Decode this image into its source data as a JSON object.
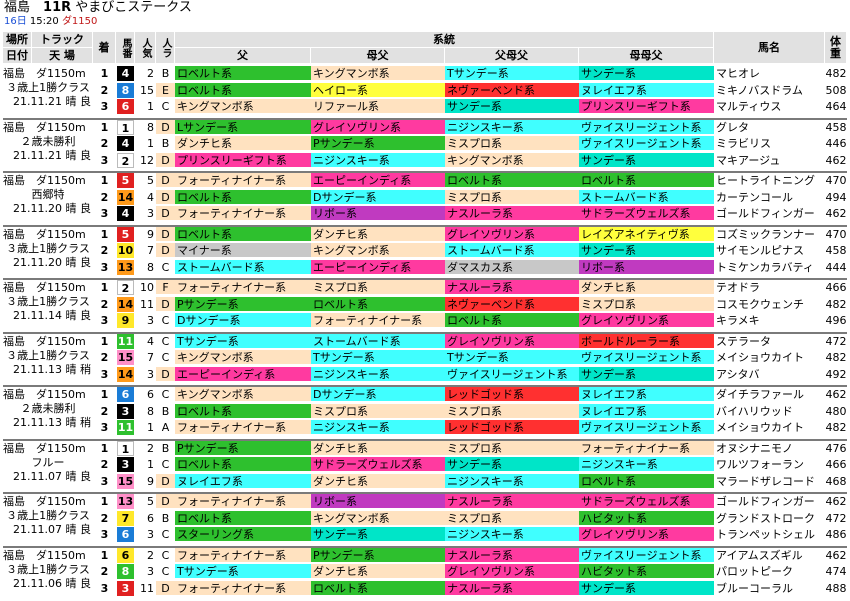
{
  "header": {
    "venue": "福島",
    "race_no": "11R",
    "race_name": "やまびこステークス",
    "day": "16日",
    "time": "15:20",
    "dist": "ダ1150"
  },
  "columns": {
    "venue_track": "場所",
    "track": "トラック",
    "date": "日付",
    "weather": "天 場",
    "chaku": "着",
    "umaban": "馬番",
    "ninki": "人気",
    "race_class": "人ラ",
    "lineage": "系統",
    "father": "父",
    "mother_side": "母父",
    "father_mother": "父母父",
    "mother_mother": "母母父",
    "horse_name": "馬名",
    "weight": "体重"
  },
  "colors": {
    "ロベルト系": "#2ec02e",
    "キングマンボ系": "#ffe2c0",
    "Tサンデー系": "#40ffff",
    "サンデー系": "#00e5c8",
    "ヘイロー系": "#ffff3d",
    "ネヴァーベンド系": "#ff3030",
    "ヌレイエフ系": "#40ffff",
    "リファール系": "#ffe2c0",
    "プリンスリーギフト系": "#ff3aa0",
    "Lサンデー系": "#40ffff",
    "グレイソヴリン系": "#ff3aa0",
    "ニジンスキー系": "#40ffff",
    "ヴァイスリージェント系": "#40ffff",
    "ダンチヒ系": "#ffe2c0",
    "Pサンデー系": "#2ec02e",
    "ミスプロ系": "#ffe2c0",
    "フォーティナイナー系": "#ffe2c0",
    "エーピーインディ系": "#ff3aa0",
    "ロベルト系2": "#2ec02e",
    "Dサンデー系": "#40ffff",
    "ストームバード系": "#40ffff",
    "リボー系": "#c03ac0",
    "ナスルーラ系": "#ff3aa0",
    "サドラーズウェルズ系": "#ff3aa0",
    "レイズアネイティヴ系": "#ffff3d",
    "マイナー系": "#c8c8c8",
    "ダマスカス系": "#c8c8c8",
    "ハビタット系": "#2ec02e",
    "ボールドルーラー系": "#ff3030",
    "レッドゴッド系": "#ff3030",
    "スターリング系": "#2ec02e"
  },
  "races": [
    {
      "venue_dist": "福島　ダ1150m",
      "cls": "３歳上1勝クラス",
      "date_w": "21.11.21 晴 良",
      "rows": [
        {
          "chaku": "1",
          "ban": "4",
          "waku": "#000000",
          "wakuText": "#ffffff",
          "ninki": "2",
          "rl": "B",
          "rlc": "#ffffff",
          "f": "ロベルト系",
          "fc": "#2ec02e",
          "mf": "キングマンボ系",
          "mfc": "#ffe2c0",
          "fmf": "Tサンデー系",
          "fmfc": "#40ffff",
          "mmf": "サンデー系",
          "mmfc": "#00e5c8",
          "name": "マヒオレ",
          "w": "482"
        },
        {
          "chaku": "2",
          "ban": "8",
          "waku": "#1a7cd6",
          "wakuText": "#ffffff",
          "ninki": "15",
          "rl": "E",
          "rlc": "#ffe2c0",
          "f": "ロベルト系",
          "fc": "#2ec02e",
          "mf": "ヘイロー系",
          "mfc": "#ffff3d",
          "fmf": "ネヴァーベンド系",
          "fmfc": "#ff3030",
          "mmf": "ヌレイエフ系",
          "mmfc": "#40ffff",
          "name": "ミキノバスドラム",
          "w": "508"
        },
        {
          "chaku": "3",
          "ban": "6",
          "waku": "#e02020",
          "wakuText": "#ffffff",
          "ninki": "1",
          "rl": "C",
          "rlc": "#ffffff",
          "f": "キングマンボ系",
          "fc": "#ffe2c0",
          "mf": "リファール系",
          "mfc": "#ffe2c0",
          "fmf": "サンデー系",
          "fmfc": "#00e5c8",
          "mmf": "プリンスリーギフト系",
          "mmfc": "#ff3aa0",
          "name": "マルティウス",
          "w": "464"
        }
      ]
    },
    {
      "venue_dist": "福島　ダ1150m",
      "cls": "２歳未勝利",
      "date_w": "21.11.21 晴 良",
      "rows": [
        {
          "chaku": "1",
          "ban": "1",
          "waku": "#ffffff",
          "wakuText": "#000000",
          "ninki": "8",
          "rl": "D",
          "rlc": "#ffe2c0",
          "f": "Lサンデー系",
          "fc": "#2ec02e",
          "mf": "グレイソヴリン系",
          "mfc": "#ff3aa0",
          "fmf": "ニジンスキー系",
          "fmfc": "#40ffff",
          "mmf": "ヴァイスリージェント系",
          "mmfc": "#40ffff",
          "name": "グレタ",
          "w": "458"
        },
        {
          "chaku": "2",
          "ban": "4",
          "waku": "#000000",
          "wakuText": "#ffffff",
          "ninki": "1",
          "rl": "B",
          "rlc": "#ffffff",
          "f": "ダンチヒ系",
          "fc": "#ffe2c0",
          "mf": "Pサンデー系",
          "mfc": "#2ec02e",
          "fmf": "ミスプロ系",
          "fmfc": "#ffe2c0",
          "mmf": "ヴァイスリージェント系",
          "mmfc": "#40ffff",
          "name": "ミラビリス",
          "w": "446"
        },
        {
          "chaku": "3",
          "ban": "2",
          "waku": "#ffffff",
          "wakuText": "#000000",
          "ninki": "12",
          "rl": "D",
          "rlc": "#ffe2c0",
          "f": "プリンスリーギフト系",
          "fc": "#ff3aa0",
          "mf": "ニジンスキー系",
          "mfc": "#40ffff",
          "fmf": "キングマンボ系",
          "fmfc": "#ffe2c0",
          "mmf": "サンデー系",
          "mmfc": "#00e5c8",
          "name": "マキアージュ",
          "w": "462"
        }
      ]
    },
    {
      "venue_dist": "福島　ダ1150m",
      "cls": "西郷特",
      "date_w": "21.11.20 晴 良",
      "rows": [
        {
          "chaku": "1",
          "ban": "5",
          "waku": "#e02020",
          "wakuText": "#ffffff",
          "ninki": "5",
          "rl": "D",
          "rlc": "#ffe2c0",
          "f": "フォーティナイナー系",
          "fc": "#ffe2c0",
          "mf": "エーピーインディ系",
          "mfc": "#ff3aa0",
          "fmf": "ロベルト系",
          "fmfc": "#2ec02e",
          "mmf": "ロベルト系",
          "mmfc": "#2ec02e",
          "name": "ヒートライトニング",
          "w": "470"
        },
        {
          "chaku": "2",
          "ban": "14",
          "waku": "#ff9a1a",
          "wakuText": "#000000",
          "ninki": "4",
          "rl": "D",
          "rlc": "#ffe2c0",
          "f": "ロベルト系",
          "fc": "#2ec02e",
          "mf": "Dサンデー系",
          "mfc": "#40ffff",
          "fmf": "ミスプロ系",
          "fmfc": "#ffe2c0",
          "mmf": "ストームバード系",
          "mmfc": "#40ffff",
          "name": "カーテンコール",
          "w": "494"
        },
        {
          "chaku": "3",
          "ban": "4",
          "waku": "#000000",
          "wakuText": "#ffffff",
          "ninki": "3",
          "rl": "D",
          "rlc": "#ffe2c0",
          "f": "フォーティナイナー系",
          "fc": "#ffe2c0",
          "mf": "リボー系",
          "mfc": "#c03ac0",
          "fmf": "ナスルーラ系",
          "fmfc": "#ff3aa0",
          "mmf": "サドラーズウェルズ系",
          "mmfc": "#ff3aa0",
          "name": "ゴールドフィンガー",
          "w": "462"
        }
      ]
    },
    {
      "venue_dist": "福島　ダ1150m",
      "cls": "３歳上1勝クラス",
      "date_w": "21.11.20 晴 良",
      "rows": [
        {
          "chaku": "1",
          "ban": "5",
          "waku": "#e02020",
          "wakuText": "#ffffff",
          "ninki": "9",
          "rl": "D",
          "rlc": "#ffe2c0",
          "f": "ロベルト系",
          "fc": "#2ec02e",
          "mf": "ダンチヒ系",
          "mfc": "#ffe2c0",
          "fmf": "グレイソヴリン系",
          "fmfc": "#ff3aa0",
          "mmf": "レイズアネイティヴ系",
          "mmfc": "#ffff3d",
          "name": "コズミックランナー",
          "w": "470"
        },
        {
          "chaku": "2",
          "ban": "10",
          "waku": "#ffe82a",
          "wakuText": "#000000",
          "ninki": "7",
          "rl": "D",
          "rlc": "#ffe2c0",
          "f": "マイナー系",
          "fc": "#c8c8c8",
          "mf": "キングマンボ系",
          "mfc": "#ffe2c0",
          "fmf": "ストームバード系",
          "fmfc": "#40ffff",
          "mmf": "サンデー系",
          "mmfc": "#00e5c8",
          "name": "サイモンルピナス",
          "w": "458"
        },
        {
          "chaku": "3",
          "ban": "13",
          "waku": "#ff9a1a",
          "wakuText": "#000000",
          "ninki": "8",
          "rl": "C",
          "rlc": "#ffffff",
          "f": "ストームバード系",
          "fc": "#40ffff",
          "mf": "エーピーインディ系",
          "mfc": "#ff3aa0",
          "fmf": "ダマスカス系",
          "fmfc": "#c8c8c8",
          "mmf": "リボー系",
          "mmfc": "#c03ac0",
          "name": "トミケンカラバティ",
          "w": "444"
        }
      ]
    },
    {
      "venue_dist": "福島　ダ1150m",
      "cls": "３歳上1勝クラス",
      "date_w": "21.11.14 晴 良",
      "rows": [
        {
          "chaku": "1",
          "ban": "2",
          "waku": "#ffffff",
          "wakuText": "#000000",
          "ninki": "10",
          "rl": "F",
          "rlc": "#ffe2c0",
          "f": "フォーティナイナー系",
          "fc": "#ffe2c0",
          "mf": "ミスプロ系",
          "mfc": "#ffe2c0",
          "fmf": "ナスルーラ系",
          "fmfc": "#ff3aa0",
          "mmf": "ダンチヒ系",
          "mmfc": "#ffe2c0",
          "name": "テオドラ",
          "w": "466"
        },
        {
          "chaku": "2",
          "ban": "14",
          "waku": "#ff9a1a",
          "wakuText": "#000000",
          "ninki": "11",
          "rl": "D",
          "rlc": "#ffe2c0",
          "f": "Pサンデー系",
          "fc": "#2ec02e",
          "mf": "ロベルト系",
          "mfc": "#2ec02e",
          "fmf": "ネヴァーベンド系",
          "fmfc": "#ff3030",
          "mmf": "ミスプロ系",
          "mmfc": "#ffe2c0",
          "name": "コスモクウェンチ",
          "w": "482"
        },
        {
          "chaku": "3",
          "ban": "9",
          "waku": "#ffe82a",
          "wakuText": "#000000",
          "ninki": "3",
          "rl": "C",
          "rlc": "#ffffff",
          "f": "Dサンデー系",
          "fc": "#40ffff",
          "mf": "フォーティナイナー系",
          "mfc": "#ffe2c0",
          "fmf": "ロベルト系",
          "fmfc": "#2ec02e",
          "mmf": "グレイソヴリン系",
          "mmfc": "#ff3aa0",
          "name": "キラメキ",
          "w": "496"
        }
      ]
    },
    {
      "venue_dist": "福島　ダ1150m",
      "cls": "３歳上1勝クラス",
      "date_w": "21.11.13 晴 稍",
      "rows": [
        {
          "chaku": "1",
          "ban": "11",
          "waku": "#2ec02e",
          "wakuText": "#ffffff",
          "ninki": "4",
          "rl": "C",
          "rlc": "#ffffff",
          "f": "Tサンデー系",
          "fc": "#40ffff",
          "mf": "ストームバード系",
          "mfc": "#40ffff",
          "fmf": "グレイソヴリン系",
          "fmfc": "#ff3aa0",
          "mmf": "ボールドルーラー系",
          "mmfc": "#ff3030",
          "name": "ステラータ",
          "w": "472"
        },
        {
          "chaku": "2",
          "ban": "15",
          "waku": "#ff8fc8",
          "wakuText": "#000000",
          "ninki": "7",
          "rl": "C",
          "rlc": "#ffffff",
          "f": "キングマンボ系",
          "fc": "#ffe2c0",
          "mf": "Tサンデー系",
          "mfc": "#40ffff",
          "fmf": "Tサンデー系",
          "fmfc": "#40ffff",
          "mmf": "ヴァイスリージェント系",
          "mmfc": "#40ffff",
          "name": "メイショウカイト",
          "w": "482"
        },
        {
          "chaku": "3",
          "ban": "14",
          "waku": "#ff9a1a",
          "wakuText": "#000000",
          "ninki": "3",
          "rl": "D",
          "rlc": "#ffe2c0",
          "f": "エーピーインディ系",
          "fc": "#ff3aa0",
          "mf": "ニジンスキー系",
          "mfc": "#40ffff",
          "fmf": "ヴァイスリージェント系",
          "fmfc": "#40ffff",
          "mmf": "サンデー系",
          "mmfc": "#00e5c8",
          "name": "アシタバ",
          "w": "492"
        }
      ]
    },
    {
      "venue_dist": "福島　ダ1150m",
      "cls": "２歳未勝利",
      "date_w": "21.11.13 晴 稍",
      "rows": [
        {
          "chaku": "1",
          "ban": "6",
          "waku": "#1a7cd6",
          "wakuText": "#ffffff",
          "ninki": "6",
          "rl": "C",
          "rlc": "#ffffff",
          "f": "キングマンボ系",
          "fc": "#ffe2c0",
          "mf": "Dサンデー系",
          "mfc": "#40ffff",
          "fmf": "レッドゴッド系",
          "fmfc": "#ff3030",
          "mmf": "ヌレイエフ系",
          "mmfc": "#40ffff",
          "name": "ダイチラファール",
          "w": "462"
        },
        {
          "chaku": "2",
          "ban": "3",
          "waku": "#000000",
          "wakuText": "#ffffff",
          "ninki": "8",
          "rl": "B",
          "rlc": "#ffffff",
          "f": "ロベルト系",
          "fc": "#2ec02e",
          "mf": "ミスプロ系",
          "mfc": "#ffe2c0",
          "fmf": "ミスプロ系",
          "fmfc": "#ffe2c0",
          "mmf": "ヌレイエフ系",
          "mmfc": "#40ffff",
          "name": "バイハリウッド",
          "w": "480"
        },
        {
          "chaku": "3",
          "ban": "11",
          "waku": "#2ec02e",
          "wakuText": "#ffffff",
          "ninki": "1",
          "rl": "A",
          "rlc": "#ffffff",
          "f": "フォーティナイナー系",
          "fc": "#ffe2c0",
          "mf": "ニジンスキー系",
          "mfc": "#40ffff",
          "fmf": "レッドゴッド系",
          "fmfc": "#ff3030",
          "mmf": "ヴァイスリージェント系",
          "mmfc": "#40ffff",
          "name": "メイショウカイト",
          "w": "482"
        }
      ]
    },
    {
      "venue_dist": "福島　ダ1150m",
      "cls": "フルー",
      "date_w": "21.11.07 晴 良",
      "rows": [
        {
          "chaku": "1",
          "ban": "1",
          "waku": "#ffffff",
          "wakuText": "#000000",
          "ninki": "2",
          "rl": "B",
          "rlc": "#ffffff",
          "f": "Pサンデー系",
          "fc": "#2ec02e",
          "mf": "ダンチヒ系",
          "mfc": "#ffe2c0",
          "fmf": "ミスプロ系",
          "fmfc": "#ffe2c0",
          "mmf": "フォーティナイナー系",
          "mmfc": "#ffe2c0",
          "name": "オヌシナニモノ",
          "w": "476"
        },
        {
          "chaku": "2",
          "ban": "3",
          "waku": "#000000",
          "wakuText": "#ffffff",
          "ninki": "1",
          "rl": "C",
          "rlc": "#ffffff",
          "f": "ロベルト系",
          "fc": "#2ec02e",
          "mf": "サドラーズウェルズ系",
          "mfc": "#ff3aa0",
          "fmf": "サンデー系",
          "fmfc": "#00e5c8",
          "mmf": "ニジンスキー系",
          "mmfc": "#40ffff",
          "name": "ワルツフォーラン",
          "w": "466"
        },
        {
          "chaku": "3",
          "ban": "15",
          "waku": "#ff8fc8",
          "wakuText": "#000000",
          "ninki": "9",
          "rl": "D",
          "rlc": "#ffe2c0",
          "f": "ヌレイエフ系",
          "fc": "#40ffff",
          "mf": "ダンチヒ系",
          "mfc": "#ffe2c0",
          "fmf": "ニジンスキー系",
          "fmfc": "#40ffff",
          "mmf": "ロベルト系",
          "mmfc": "#2ec02e",
          "name": "マラードザレコード",
          "w": "468"
        }
      ]
    },
    {
      "venue_dist": "福島　ダ1150m",
      "cls": "３歳上1勝クラス",
      "date_w": "21.11.07 晴 良",
      "rows": [
        {
          "chaku": "1",
          "ban": "13",
          "waku": "#ff8fc8",
          "wakuText": "#000000",
          "ninki": "5",
          "rl": "D",
          "rlc": "#ffe2c0",
          "f": "フォーティナイナー系",
          "fc": "#ffe2c0",
          "mf": "リボー系",
          "mfc": "#c03ac0",
          "fmf": "ナスルーラ系",
          "fmfc": "#ff3aa0",
          "mmf": "サドラーズウェルズ系",
          "mmfc": "#ff3aa0",
          "name": "ゴールドフィンガー",
          "w": "462"
        },
        {
          "chaku": "2",
          "ban": "7",
          "waku": "#ffe82a",
          "wakuText": "#000000",
          "ninki": "6",
          "rl": "B",
          "rlc": "#ffffff",
          "f": "ロベルト系",
          "fc": "#2ec02e",
          "mf": "キングマンボ系",
          "mfc": "#ffe2c0",
          "fmf": "ミスプロ系",
          "fmfc": "#ffe2c0",
          "mmf": "ハビタット系",
          "mmfc": "#2ec02e",
          "name": "グランドストローク",
          "w": "472"
        },
        {
          "chaku": "3",
          "ban": "6",
          "waku": "#1a7cd6",
          "wakuText": "#ffffff",
          "ninki": "3",
          "rl": "C",
          "rlc": "#ffffff",
          "f": "スターリング系",
          "fc": "#2ec02e",
          "mf": "サンデー系",
          "mfc": "#00e5c8",
          "fmf": "ニジンスキー系",
          "fmfc": "#40ffff",
          "mmf": "グレイソヴリン系",
          "mmfc": "#ff3aa0",
          "name": "トランペットシェル",
          "w": "486"
        }
      ]
    },
    {
      "venue_dist": "福島　ダ1150m",
      "cls": "３歳上1勝クラス",
      "date_w": "21.11.06 晴 良",
      "rows": [
        {
          "chaku": "1",
          "ban": "6",
          "waku": "#ffe82a",
          "wakuText": "#000000",
          "ninki": "2",
          "rl": "C",
          "rlc": "#ffffff",
          "f": "フォーティナイナー系",
          "fc": "#ffe2c0",
          "mf": "Pサンデー系",
          "mfc": "#2ec02e",
          "fmf": "ナスルーラ系",
          "fmfc": "#ff3aa0",
          "mmf": "ヴァイスリージェント系",
          "mmfc": "#40ffff",
          "name": "アイアムスズギル",
          "w": "462"
        },
        {
          "chaku": "2",
          "ban": "8",
          "waku": "#2ec02e",
          "wakuText": "#ffffff",
          "ninki": "3",
          "rl": "C",
          "rlc": "#ffffff",
          "f": "Tサンデー系",
          "fc": "#40ffff",
          "mf": "ダンチヒ系",
          "mfc": "#ffe2c0",
          "fmf": "グレイソヴリン系",
          "fmfc": "#ff3aa0",
          "mmf": "ハビタット系",
          "mmfc": "#2ec02e",
          "name": "パロットピーク",
          "w": "474"
        },
        {
          "chaku": "3",
          "ban": "3",
          "waku": "#e02020",
          "wakuText": "#ffffff",
          "ninki": "11",
          "rl": "D",
          "rlc": "#ffe2c0",
          "f": "フォーティナイナー系",
          "fc": "#ffe2c0",
          "mf": "ロベルト系",
          "mfc": "#2ec02e",
          "fmf": "ナスルーラ系",
          "fmfc": "#ff3aa0",
          "mmf": "サンデー系",
          "mmfc": "#00e5c8",
          "name": "ブルーコーラル",
          "w": "488"
        }
      ]
    }
  ]
}
